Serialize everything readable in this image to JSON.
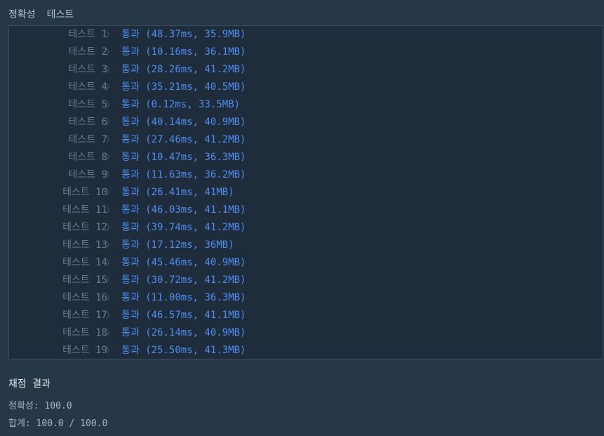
{
  "header": {
    "accuracy_tab": "정확성",
    "test_tab": "테스트"
  },
  "tests": [
    {
      "label": "테스트 1",
      "result": "통과 (48.37ms, 35.9MB)"
    },
    {
      "label": "테스트 2",
      "result": "통과 (10.16ms, 36.1MB)"
    },
    {
      "label": "테스트 3",
      "result": "통과 (28.26ms, 41.2MB)"
    },
    {
      "label": "테스트 4",
      "result": "통과 (35.21ms, 40.5MB)"
    },
    {
      "label": "테스트 5",
      "result": "통과 (0.12ms, 33.5MB)"
    },
    {
      "label": "테스트 6",
      "result": "통과 (40.14ms, 40.9MB)"
    },
    {
      "label": "테스트 7",
      "result": "통과 (27.46ms, 41.2MB)"
    },
    {
      "label": "테스트 8",
      "result": "통과 (10.47ms, 36.3MB)"
    },
    {
      "label": "테스트 9",
      "result": "통과 (11.63ms, 36.2MB)"
    },
    {
      "label": "테스트 10",
      "result": "통과 (26.41ms, 41MB)"
    },
    {
      "label": "테스트 11",
      "result": "통과 (46.03ms, 41.1MB)"
    },
    {
      "label": "테스트 12",
      "result": "통과 (39.74ms, 41.2MB)"
    },
    {
      "label": "테스트 13",
      "result": "통과 (17.12ms, 36MB)"
    },
    {
      "label": "테스트 14",
      "result": "통과 (45.46ms, 40.9MB)"
    },
    {
      "label": "테스트 15",
      "result": "통과 (30.72ms, 41.2MB)"
    },
    {
      "label": "테스트 16",
      "result": "통과 (11.00ms, 36.3MB)"
    },
    {
      "label": "테스트 17",
      "result": "통과 (46.57ms, 41.1MB)"
    },
    {
      "label": "테스트 18",
      "result": "통과 (26.14ms, 40.9MB)"
    },
    {
      "label": "테스트 19",
      "result": "통과 (25.50ms, 41.3MB)"
    }
  ],
  "summary": {
    "title": "채점 결과",
    "accuracy": "정확성: 100.0",
    "total": "합계: 100.0 / 100.0"
  },
  "colors": {
    "background": "#263747",
    "panel": "#1e2c3b",
    "pass": "#4f8ef0",
    "label": "#6b7b8c"
  }
}
